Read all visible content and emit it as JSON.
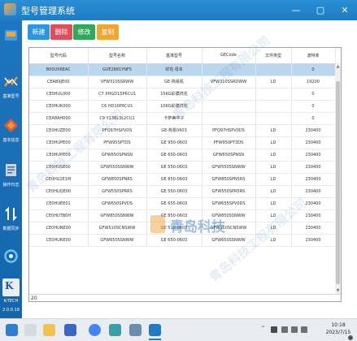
{
  "window": {
    "title": "型号管理系统",
    "minimize_glyph": "—",
    "maximize_glyph": "▢",
    "close_glyph": "✕"
  },
  "sidebar": {
    "items": [
      {
        "label": "",
        "icon": "device-icon",
        "color": "#3aa0e8"
      },
      {
        "label": "基准型号",
        "icon": "chart-icon",
        "color": "#f29a2e"
      },
      {
        "label": "基本信息",
        "icon": "diamond-icon",
        "color": "#e35a3a"
      },
      {
        "label": "操作日志",
        "icon": "document-icon",
        "color": "#c7d6e6"
      },
      {
        "label": "数据同步",
        "icon": "sync-arrows-icon",
        "color": "#ffffff"
      },
      {
        "label": "",
        "icon": "circle-refresh-icon",
        "color": "#6fc4f2"
      }
    ],
    "logo_text": "K",
    "logo_caption": "K-TECH",
    "version": "2.0.0.19"
  },
  "toolbar": {
    "new_label": "新建",
    "delete_label": "删除",
    "modify_label": "修改",
    "copy_label": "复制"
  },
  "table": {
    "columns": [
      "型号代码",
      "型号名称",
      "基准型号",
      "GECode",
      "文件类型",
      "波特率"
    ],
    "rows": [
      [
        "B00UX6EAC",
        "GVE2881YNFS",
        "祥花·母本",
        "",
        "",
        "0"
      ],
      [
        "CEAB9JE00",
        "VFW310SSRWW",
        "GE-简易机",
        "VFW310SSRDWW",
        "LD",
        "19200"
      ],
      [
        "CE0HUL000",
        "C7 XHGD15P6CU1",
        "15KG彩膜祥花",
        "",
        "",
        "0"
      ],
      [
        "CE0HUK000",
        "C6 HD10P6CU1",
        "10KG彩膜祥花",
        "",
        "",
        "0"
      ],
      [
        "CEA8AH000",
        "C9 Y13BL3L2CU1",
        "卡萨蒂中子",
        "",
        "",
        "0"
      ],
      [
        "CE0HUZE00",
        "PFQ97HSPVDS",
        "GE-热泵0603",
        "PFQ97HSPV0DS",
        "LD",
        "230400"
      ],
      [
        "CE0HUPE00",
        "PFW95SPTDS",
        "GE 950-0603",
        "PFW950PT3DS",
        "LD",
        "230400"
      ],
      [
        "CE0HUPE00",
        "GFW650SPNSN",
        "GE 650-0603",
        "GFW650SPNSN",
        "LD",
        "230400"
      ],
      [
        "CE0HUSE00",
        "GFW550SSNWW",
        "GE 550-0603",
        "GFW550SSNWW",
        "LD",
        "230400"
      ],
      [
        "CE0HU2E1M",
        "GFW850SPNRS",
        "GE 850-0603",
        "GFW850SPN5RS",
        "LD",
        "230400"
      ],
      [
        "CE0HUQE00",
        "GFW550SPRRS",
        "GE 550-0603",
        "GFW550SPR5RS",
        "LD",
        "230400"
      ],
      [
        "CE0HUEE01",
        "GFW650SPVDS",
        "GE 655-0603",
        "GFW655SPV0DS",
        "LD",
        "230400"
      ],
      [
        "CE0HUTB0H",
        "GFW850SSNWW",
        "GE 850-0603",
        "GFW850SSNWW",
        "LD",
        "230400"
      ],
      [
        "CE0HUNE00",
        "GFW510SCNSWW",
        "GE 510-0603",
        "GFW510SCN5WW",
        "LD",
        "230400"
      ],
      [
        "CE0HURE00",
        "GFW650SSNWW",
        "GE 650-0603",
        "GFW650SSNWW",
        "LD",
        "230400"
      ]
    ],
    "selected_row": 0,
    "record_count": "20"
  },
  "watermarks": {
    "company": "青岛科技工程有限公司",
    "brand_text": "青岛科技"
  },
  "taskbar": {
    "tray_chevron": "^",
    "time": "10:18",
    "date": "2023/7/15"
  },
  "colors": {
    "titlebar": "#1f7cc4",
    "sidebar": "#1565ab",
    "selected_row": "#b9d7ee",
    "new_button": "#2b97e3",
    "delete_button": "#e14d5a",
    "modify_button": "#31a95c",
    "copy_button": "#f2a531"
  }
}
